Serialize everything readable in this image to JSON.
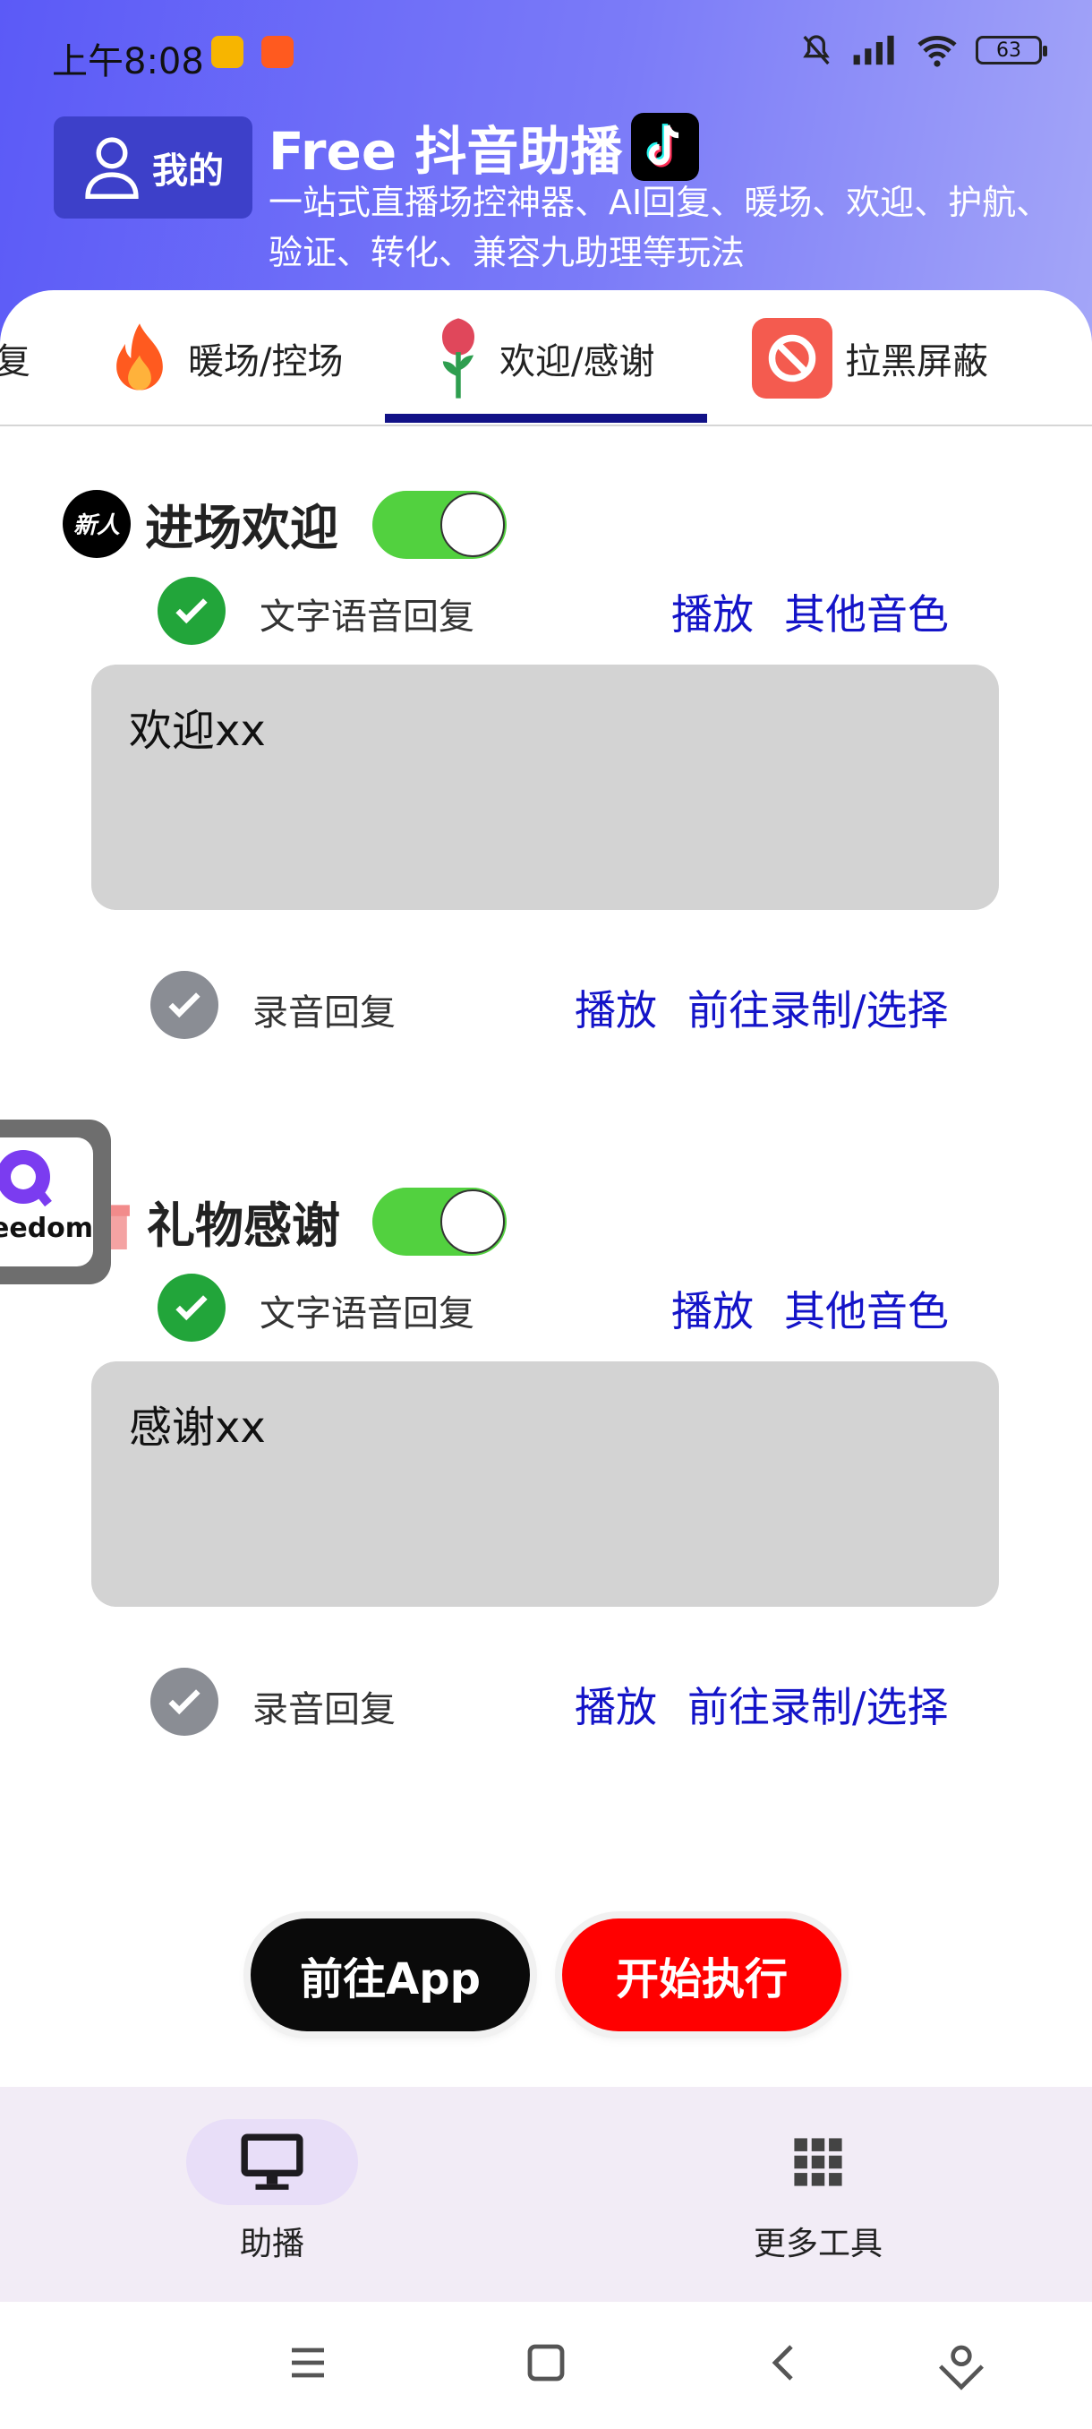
{
  "status_bar": {
    "time": "上午8:08",
    "battery": "63"
  },
  "header": {
    "me_label": "我的",
    "title": "Free 抖音助播",
    "subtitle": "一站式直播场控神器、AI回复、暖场、欢迎、护航、验证、转化、兼容九助理等玩法"
  },
  "tabs": [
    {
      "label": "复",
      "icon": "reply-icon"
    },
    {
      "label": "暖场/控场",
      "icon": "fire-icon"
    },
    {
      "label": "欢迎/感谢",
      "icon": "rose-icon"
    },
    {
      "label": "拉黑屏蔽",
      "icon": "block-icon"
    }
  ],
  "welcome": {
    "icon_text": "新人",
    "title": "进场欢迎",
    "toggle_on": true,
    "text_voice_label": "文字语音回复",
    "play_label": "播放",
    "other_voice_label": "其他音色",
    "message": "欢迎xx",
    "record_label": "录音回复",
    "record_play_label": "播放",
    "goto_record_label": "前往录制/选择"
  },
  "gift": {
    "title": "礼物感谢",
    "toggle_on": true,
    "text_voice_label": "文字语音回复",
    "play_label": "播放",
    "other_voice_label": "其他音色",
    "message": "感谢xx",
    "record_label": "录音回复",
    "record_play_label": "播放",
    "goto_record_label": "前往录制/选择"
  },
  "float_widget": {
    "text": "eedom"
  },
  "actions": {
    "goto_app": "前往App",
    "start": "开始执行"
  },
  "bottom_nav": [
    {
      "label": "助播",
      "icon": "monitor-icon",
      "active": true
    },
    {
      "label": "更多工具",
      "icon": "grid-icon",
      "active": false
    }
  ],
  "colors": {
    "header_start": "#5b5af7",
    "link": "#1414c8",
    "toggle_on": "#52d13f",
    "start_button": "#ff0000"
  }
}
